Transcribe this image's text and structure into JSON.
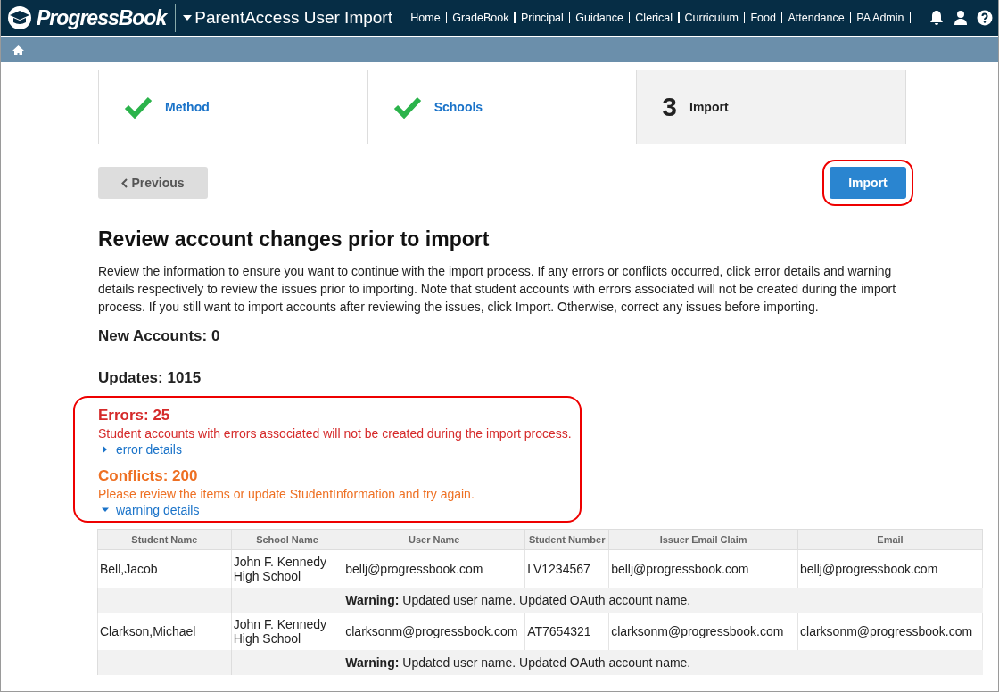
{
  "header": {
    "logo": "ProgressBook",
    "app_title": "ParentAccess User Import",
    "nav": [
      "Home",
      "GradeBook",
      "Principal",
      "Guidance",
      "Clerical",
      "Curriculum",
      "Food",
      "Attendance",
      "PA Admin"
    ]
  },
  "steps": [
    {
      "kind": "done",
      "label": "Method"
    },
    {
      "kind": "done",
      "label": "Schools"
    },
    {
      "kind": "current",
      "number": "3",
      "label": "Import"
    }
  ],
  "previous_button": "Previous",
  "import_button": {
    "label": "Import",
    "highlighted": true
  },
  "heading": "Review account changes prior to import",
  "intro": "Review the information to ensure you want to continue with the import process. If any errors or conflicts occurred, click error details and warning details respectively to review the issues prior to importing. Note that student accounts with errors associated will not be created during the import process. If you still want to import accounts after reviewing the issues, click Import. Otherwise, correct any issues before importing.",
  "new_accounts": "New Accounts: 0",
  "updates": "Updates: 1015",
  "issues": {
    "highlighted": true,
    "groups": [
      {
        "kind": "error",
        "title": "Errors: 25",
        "message": "Student accounts with errors associated will not be created during the import process.",
        "link": "error details",
        "expanded": false
      },
      {
        "kind": "conflict",
        "title": "Conflicts: 200",
        "message": "Please review the items or update StudentInformation and try again.",
        "link": "warning details",
        "expanded": true
      }
    ]
  },
  "table": {
    "columns": [
      "Student Name",
      "School Name",
      "User Name",
      "Student Number",
      "Issuer Email Claim",
      "Email"
    ],
    "rows": [
      {
        "kind": "record",
        "cells": [
          "Bell,Jacob",
          "John F. Kennedy High School",
          "bellj@progressbook.com",
          "LV1234567",
          "bellj@progressbook.com",
          "bellj@progressbook.com"
        ]
      },
      {
        "kind": "warning",
        "text": "**Warning:** Updated user name. Updated OAuth account name."
      },
      {
        "kind": "record",
        "cells": [
          "Clarkson,Michael",
          "John F. Kennedy High School",
          "clarksonm@progressbook.com",
          "AT7654321",
          "clarksonm@progressbook.com",
          "clarksonm@progressbook.com"
        ]
      },
      {
        "kind": "warning",
        "text": "**Warning:** Updated user name. Updated OAuth account name."
      }
    ]
  }
}
